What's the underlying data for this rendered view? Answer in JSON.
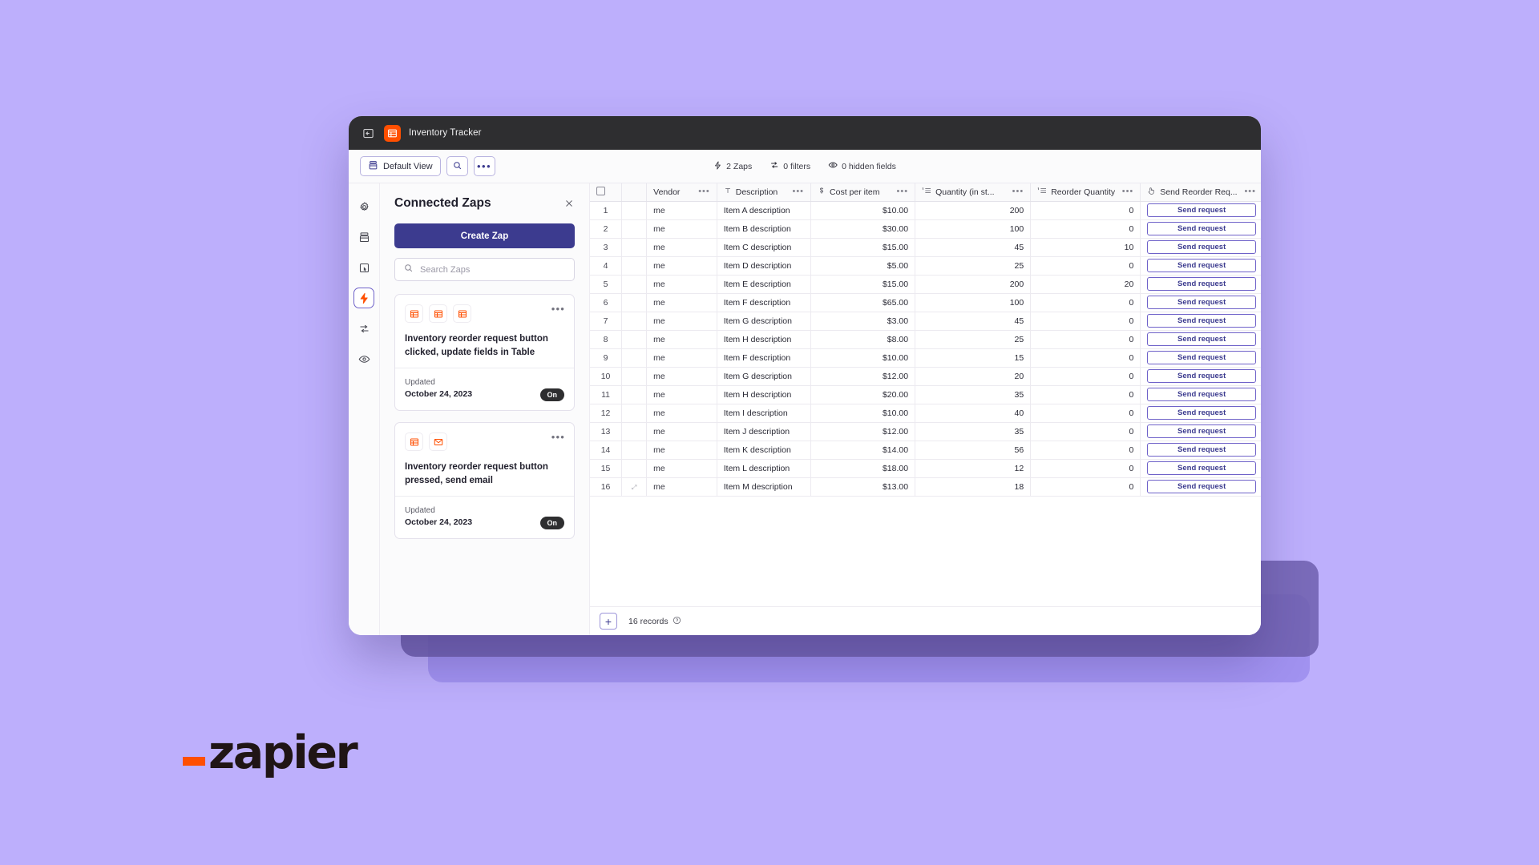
{
  "window": {
    "titlebar": {
      "app_name": "Inventory Tracker",
      "back_icon": "back-arrow-icon",
      "app_icon": "table-app-icon"
    },
    "toolbar": {
      "view_button": "Default View",
      "view_icon": "view-stack-icon",
      "search_icon": "search-icon",
      "more_icon": "ellipsis-icon",
      "meta": [
        {
          "icon": "lightning-icon",
          "label": "2 Zaps"
        },
        {
          "icon": "filter-icon",
          "label": "0 filters"
        },
        {
          "icon": "eye-icon",
          "label": "0 hidden fields"
        }
      ]
    }
  },
  "rail": {
    "items": [
      {
        "name": "settings",
        "icon": "gear-icon",
        "active": false
      },
      {
        "name": "data",
        "icon": "stack-icon",
        "active": false
      },
      {
        "name": "interfaces",
        "icon": "page-cursor-icon",
        "active": false
      },
      {
        "name": "zaps",
        "icon": "lightning-icon",
        "active": true
      },
      {
        "name": "filters",
        "icon": "sliders-icon",
        "active": false
      },
      {
        "name": "hidden-fields",
        "icon": "eye-icon",
        "active": false
      }
    ]
  },
  "zaps_panel": {
    "title": "Connected Zaps",
    "close_icon": "close-icon",
    "create_button": "Create Zap",
    "search_placeholder": "Search Zaps",
    "search_value": "",
    "search_icon": "search-icon",
    "cards": [
      {
        "app_icons": [
          "table-icon",
          "table-icon",
          "table-icon"
        ],
        "title": "Inventory reorder request button clicked, update fields in Table",
        "updated_label": "Updated",
        "updated_date": "October 24, 2023",
        "toggle": "On",
        "more_icon": "ellipsis-icon"
      },
      {
        "app_icons": [
          "table-icon",
          "email-icon"
        ],
        "title": "Inventory reorder request button pressed, send email",
        "updated_label": "Updated",
        "updated_date": "October 24, 2023",
        "toggle": "On",
        "more_icon": "ellipsis-icon"
      }
    ]
  },
  "table": {
    "columns": [
      {
        "key": "select",
        "label": "",
        "icon": "checkbox-icon"
      },
      {
        "key": "name",
        "label": "Vendor",
        "icon": ""
      },
      {
        "key": "description",
        "label": "Description",
        "icon": "text-field-icon"
      },
      {
        "key": "cost",
        "label": "Cost per item",
        "icon": "currency-icon"
      },
      {
        "key": "quantity",
        "label": "Quantity (in st...",
        "icon": "number-field-icon"
      },
      {
        "key": "reorder",
        "label": "Reorder Quantity",
        "icon": "number-field-icon"
      },
      {
        "key": "button",
        "label": "Send Reorder Req...",
        "icon": "button-field-icon"
      }
    ],
    "rows": [
      {
        "idx": "1",
        "name": "me",
        "description": "Item A description",
        "cost": "$10.00",
        "quantity": "200",
        "reorder": "0",
        "button": "Send request"
      },
      {
        "idx": "2",
        "name": "me",
        "description": "Item B description",
        "cost": "$30.00",
        "quantity": "100",
        "reorder": "0",
        "button": "Send request"
      },
      {
        "idx": "3",
        "name": "me",
        "description": "Item C description",
        "cost": "$15.00",
        "quantity": "45",
        "reorder": "10",
        "button": "Send request"
      },
      {
        "idx": "4",
        "name": "me",
        "description": "Item D description",
        "cost": "$5.00",
        "quantity": "25",
        "reorder": "0",
        "button": "Send request"
      },
      {
        "idx": "5",
        "name": "me",
        "description": "Item E description",
        "cost": "$15.00",
        "quantity": "200",
        "reorder": "20",
        "button": "Send request"
      },
      {
        "idx": "6",
        "name": "me",
        "description": "Item F description",
        "cost": "$65.00",
        "quantity": "100",
        "reorder": "0",
        "button": "Send request"
      },
      {
        "idx": "7",
        "name": "me",
        "description": "Item G description",
        "cost": "$3.00",
        "quantity": "45",
        "reorder": "0",
        "button": "Send request"
      },
      {
        "idx": "8",
        "name": "me",
        "description": "Item H description",
        "cost": "$8.00",
        "quantity": "25",
        "reorder": "0",
        "button": "Send request"
      },
      {
        "idx": "9",
        "name": "me",
        "description": "Item F description",
        "cost": "$10.00",
        "quantity": "15",
        "reorder": "0",
        "button": "Send request"
      },
      {
        "idx": "10",
        "name": "me",
        "description": "Item G description",
        "cost": "$12.00",
        "quantity": "20",
        "reorder": "0",
        "button": "Send request"
      },
      {
        "idx": "11",
        "name": "me",
        "description": "Item H description",
        "cost": "$20.00",
        "quantity": "35",
        "reorder": "0",
        "button": "Send request"
      },
      {
        "idx": "12",
        "name": "me",
        "description": "Item I description",
        "cost": "$10.00",
        "quantity": "40",
        "reorder": "0",
        "button": "Send request"
      },
      {
        "idx": "13",
        "name": "me",
        "description": "Item J description",
        "cost": "$12.00",
        "quantity": "35",
        "reorder": "0",
        "button": "Send request"
      },
      {
        "idx": "14",
        "name": "me",
        "description": "Item K description",
        "cost": "$14.00",
        "quantity": "56",
        "reorder": "0",
        "button": "Send request"
      },
      {
        "idx": "15",
        "name": "me",
        "description": "Item L description",
        "cost": "$18.00",
        "quantity": "12",
        "reorder": "0",
        "button": "Send request"
      },
      {
        "idx": "16",
        "name": "me",
        "description": "Item M description",
        "cost": "$13.00",
        "quantity": "18",
        "reorder": "0",
        "button": "Send request"
      }
    ],
    "footer": {
      "add_row_glyph": "+",
      "records_label": "16 records",
      "help_icon": "help-circle-icon"
    }
  },
  "branding": {
    "logo_word": "zapier",
    "logo_accent_color": "#ff4f00",
    "background_color": "#bdaffc"
  }
}
